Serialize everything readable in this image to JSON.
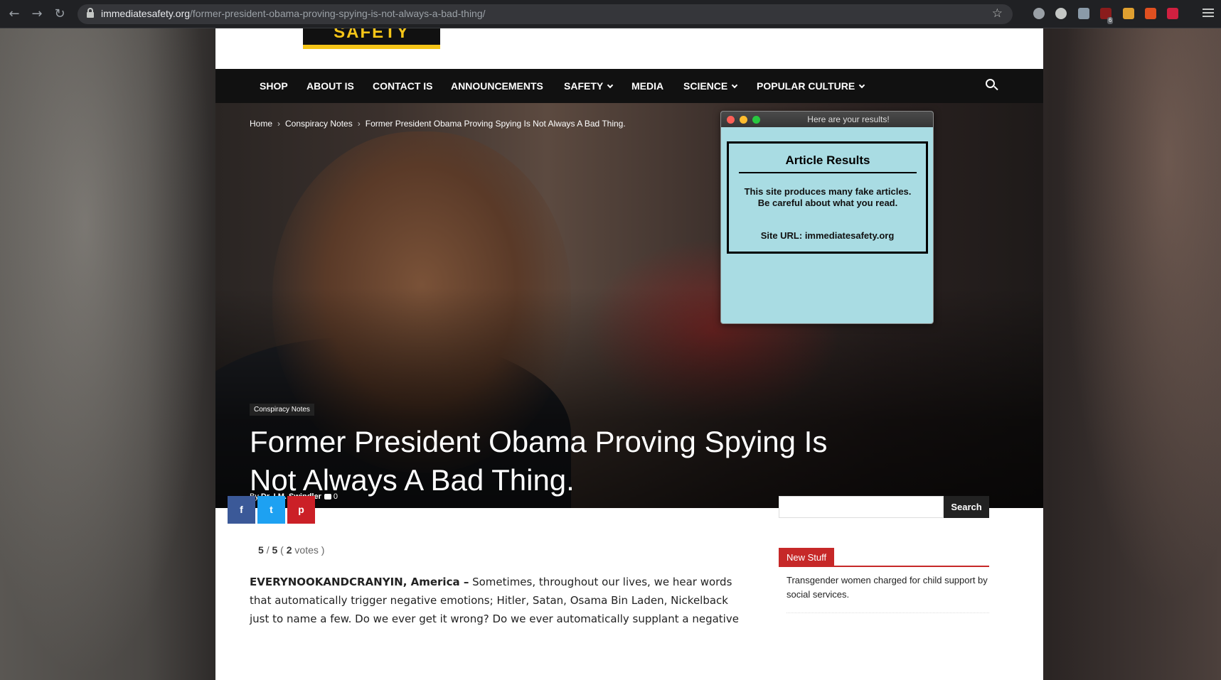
{
  "browser": {
    "url_domain": "immediatesafety.org",
    "url_path": "/former-president-obama-proving-spying-is-not-always-a-bad-thing/",
    "extension_badge": "6"
  },
  "site": {
    "logo_text": "SAFETY",
    "nav": [
      {
        "label": "SHOP"
      },
      {
        "label": "ABOUT IS"
      },
      {
        "label": "CONTACT IS"
      },
      {
        "label": "ANNOUNCEMENTS"
      },
      {
        "label": "SAFETY"
      },
      {
        "label": "MEDIA"
      },
      {
        "label": "SCIENCE"
      },
      {
        "label": "POPULAR CULTURE"
      }
    ],
    "breadcrumb": {
      "home": "Home",
      "sep": "›",
      "category": "Conspiracy Notes",
      "current": "Former President Obama Proving Spying Is Not Always A Bad Thing."
    },
    "category_tag": "Conspiracy Notes",
    "title": "Former President Obama Proving Spying Is Not Always A Bad Thing.",
    "byline": {
      "by": "By",
      "author": "Dr. I.M. Swindler",
      "comments": "0"
    },
    "share": {
      "facebook": "f",
      "twitter": "t",
      "pinterest": "p"
    },
    "rating": {
      "score": "5",
      "slash": "/",
      "max": "5",
      "votes_count": "2",
      "votes_label": "votes"
    },
    "article": {
      "lead": "EVERYNOOKANDCRANYIN, America –",
      "text": "Sometimes, throughout our lives, we hear words that automatically trigger negative emotions; Hitler, Satan, Osama Bin Laden, Nickelback just to name a few. Do we ever get it wrong? Do we ever automatically supplant a negative"
    },
    "sidebar": {
      "search_button": "Search",
      "widget_title": "New Stuff",
      "item": "Transgender women charged for child support by social services."
    }
  },
  "popup": {
    "window_title": "Here are your results!",
    "heading": "Article Results",
    "message": "This site produces many fake articles. Be careful about what you read.",
    "site_url_label": "Site URL: immediatesafety.org"
  },
  "colors": {
    "popup_bg": "#a9dce3",
    "nav_bg": "#111111",
    "facebook": "#3b5998",
    "twitter": "#1da1f2",
    "pinterest": "#cb2027",
    "widget_accent": "#c62828"
  }
}
